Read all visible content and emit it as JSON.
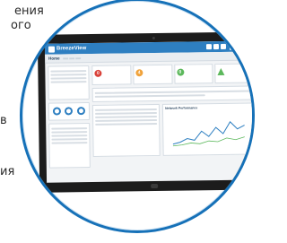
{
  "background_text": {
    "line1": "ения",
    "line2": "ого",
    "line3": "в",
    "line4": "ия"
  },
  "app": {
    "brand": "BreezeView",
    "header_buttons": [
      "",
      "",
      ""
    ],
    "subtitle": "Home"
  },
  "alerts": [
    {
      "label": "",
      "count": "0",
      "status": "red"
    },
    {
      "label": "",
      "count": "4",
      "status": "orange"
    },
    {
      "label": "",
      "count": "0",
      "status": "green"
    },
    {
      "label": "",
      "count": "",
      "status": "green-triangle"
    }
  ],
  "panels": {
    "network_performance": "Network Performance",
    "net_stats": [
      "",
      "",
      "",
      ""
    ]
  },
  "colors": {
    "accent": "#1671b8",
    "appbar": "#2e7fc1",
    "red": "#d9423a",
    "orange": "#f0a23a",
    "green": "#5cb85c"
  }
}
